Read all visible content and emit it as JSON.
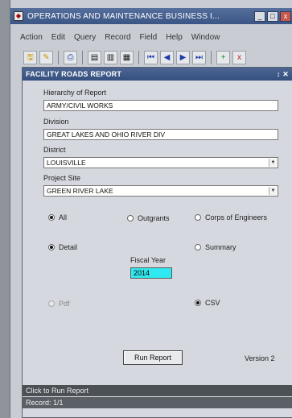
{
  "window": {
    "title": "OPERATIONS AND MAINTENANCE BUSINESS I...",
    "min": "_",
    "max": "□",
    "close": "x"
  },
  "menu": [
    "Action",
    "Edit",
    "Query",
    "Record",
    "Field",
    "Help",
    "Window"
  ],
  "toolbar": {
    "icons": [
      "save-icon",
      "open-icon",
      "print-icon",
      "copy-icon",
      "cut-icon",
      "paste-icon",
      "first-icon",
      "prev-icon",
      "next-icon",
      "last-icon",
      "insert-icon",
      "delete-icon"
    ],
    "glyphs": [
      "🖫",
      "✎",
      "⎙",
      "▤",
      "▥",
      "▦",
      "⏮",
      "◀",
      "▶",
      "⏭",
      "+",
      "x"
    ]
  },
  "panel": {
    "title": "FACILITY ROADS REPORT",
    "controls": "↕ ✕"
  },
  "form": {
    "hierarchy_label": "Hierarchy of Report",
    "hierarchy_value": "ARMY/CIVIL WORKS",
    "division_label": "Division",
    "division_value": "GREAT LAKES AND OHIO RIVER DIV",
    "district_label": "District",
    "district_value": "LOUISVILLE",
    "project_label": "Project Site",
    "project_value": "GREEN RIVER LAKE",
    "grant_all": "All",
    "grant_outgrants": "Outgrants",
    "grant_corps": "Corps of Engineers",
    "detail": "Detail",
    "summary": "Summary",
    "fiscal_label": "Fiscal Year",
    "fiscal_value": "2014",
    "pdf": "Pdf",
    "csv": "CSV",
    "run_button": "Run Report",
    "version": "Version 2"
  },
  "status": {
    "message": "Click to Run Report",
    "record": "Record: 1/1"
  }
}
